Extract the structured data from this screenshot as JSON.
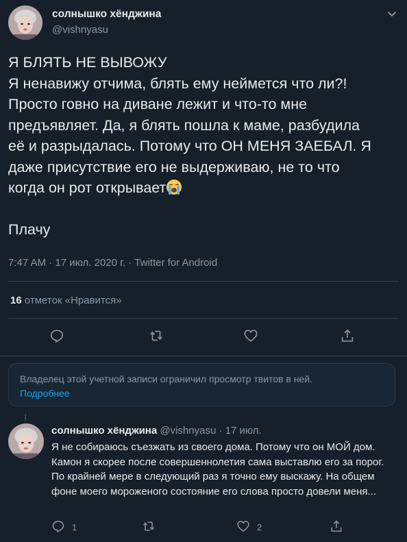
{
  "main_tweet": {
    "display_name": "солнышко хёнджина",
    "handle": "@vishnyasu",
    "text": "Я БЛЯТЬ НЕ ВЫВОЖУ\nЯ ненавижу отчима, блять ему неймется что ли?!\nПросто говно на диване лежит и что-то мне\nпредъявляет. Да, я блять пошла к маме, разбудила\nеё и разрыдалась. Потому что ОН МЕНЯ ЗАЕБАЛ. Я\nдаже присутствие его не выдерживаю, не то что\nкогда он рот открывает",
    "text_last": "Плачу",
    "meta": "7:47 AM · 17 июл. 2020 г. · Twitter for Android",
    "likes_count": "16",
    "likes_label": "отметок «Нравится»"
  },
  "notice": {
    "text": "Владелец этой учетной записи ограничил просмотр твитов в ней.",
    "link": "Подробнее"
  },
  "reply_tweet": {
    "display_name": "солнышко хёнджина",
    "handle": "@vishnyasu",
    "dot": "·",
    "date": "17 июл.",
    "text": "Я не собираюсь съезжать из своего дома. Потому что он МОЙ дом. Камон я скорее после совершеннолетия сама выставлю его за порог. По крайней мере в следующий раз я точно ему выскажу. На общем фоне моего мороженого состояние его слова просто довели меня...",
    "reply_count": "1",
    "like_count": "2"
  },
  "icons": {
    "reply": "speech-bubble-icon",
    "retweet": "retweet-icon",
    "like": "heart-icon",
    "share": "share-icon",
    "caret": "chevron-down-icon",
    "emoji": "loudly-crying-face"
  },
  "colors": {
    "background": "#15202b",
    "text": "#e8eaeb",
    "secondary": "#8899a6",
    "link": "#1da1f2",
    "divider": "#38444d"
  }
}
